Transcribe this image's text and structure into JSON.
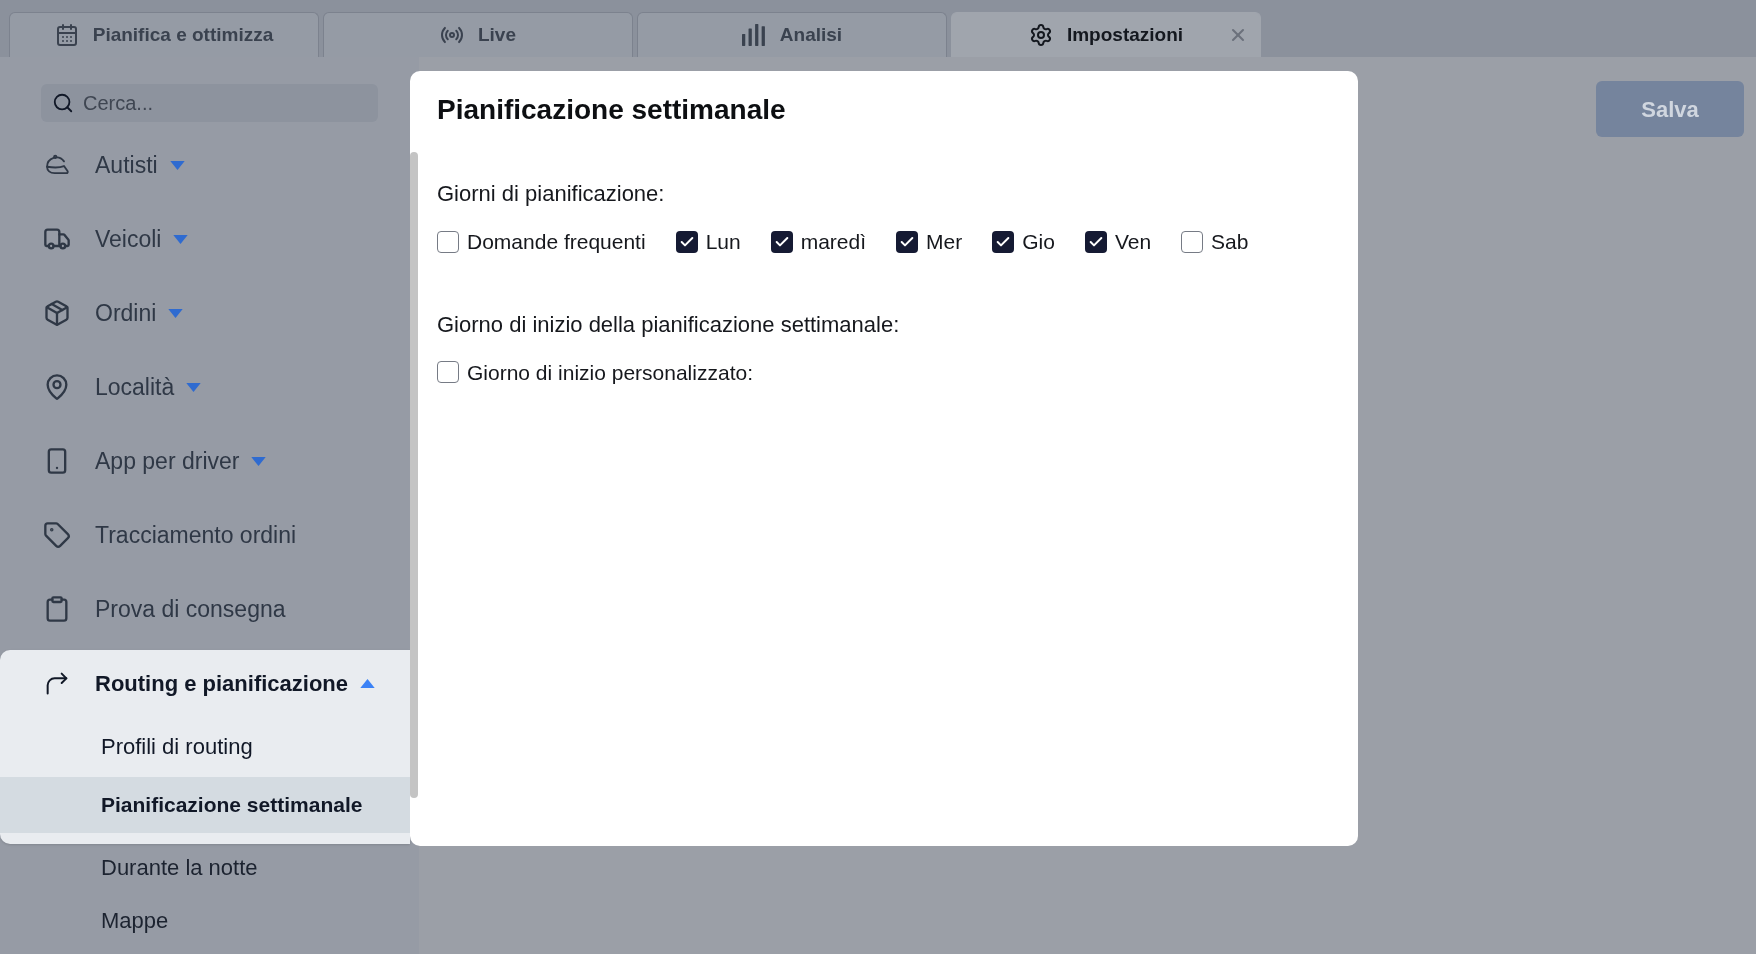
{
  "tabs": [
    {
      "label": "Pianifica e ottimizza",
      "selected": false
    },
    {
      "label": "Live",
      "selected": false
    },
    {
      "label": "Analisi",
      "selected": false
    },
    {
      "label": "Impostazioni",
      "selected": true
    }
  ],
  "sidebar": {
    "search": {
      "placeholder": "Cerca..."
    },
    "items": [
      {
        "kind": "group",
        "label": "Autisti",
        "expanded": false,
        "highlighted": false
      },
      {
        "kind": "group",
        "label": "Veicoli",
        "expanded": false,
        "highlighted": false
      },
      {
        "kind": "group",
        "label": "Ordini",
        "expanded": false,
        "highlighted": false
      },
      {
        "kind": "group",
        "label": "Località",
        "expanded": false,
        "highlighted": false
      },
      {
        "kind": "group",
        "label": "App per driver",
        "expanded": false,
        "highlighted": false
      },
      {
        "kind": "link",
        "label": "Tracciamento ordini",
        "highlighted": false
      },
      {
        "kind": "link",
        "label": "Prova di consegna",
        "highlighted": false
      },
      {
        "kind": "group",
        "label": "Routing e pianificazione",
        "expanded": true,
        "highlighted": true,
        "children": [
          {
            "label": "Profili di routing",
            "selected": false,
            "highlighted": true
          },
          {
            "label": "Pianificazione settimanale",
            "selected": true,
            "highlighted": true
          },
          {
            "label": "Durante la notte",
            "selected": false,
            "highlighted": false
          },
          {
            "label": "Mappe",
            "selected": false,
            "highlighted": false
          }
        ]
      }
    ]
  },
  "panel": {
    "title": "Pianificazione settimanale",
    "sections": [
      {
        "label": "Giorni di pianificazione:",
        "options": [
          {
            "label": "Domande frequenti",
            "checked": false
          },
          {
            "label": "Lun",
            "checked": true
          },
          {
            "label": "maredì",
            "checked": true
          },
          {
            "label": "Mer",
            "checked": true
          },
          {
            "label": "Gio",
            "checked": true
          },
          {
            "label": "Ven",
            "checked": true
          },
          {
            "label": "Sab",
            "checked": false
          }
        ]
      },
      {
        "label": "Giorno di inizio della pianificazione settimanale:",
        "options": [
          {
            "label": "Giorno di inizio personalizzato:",
            "checked": false
          }
        ]
      }
    ]
  },
  "save_button": {
    "label": "Salva",
    "disabled": true
  }
}
